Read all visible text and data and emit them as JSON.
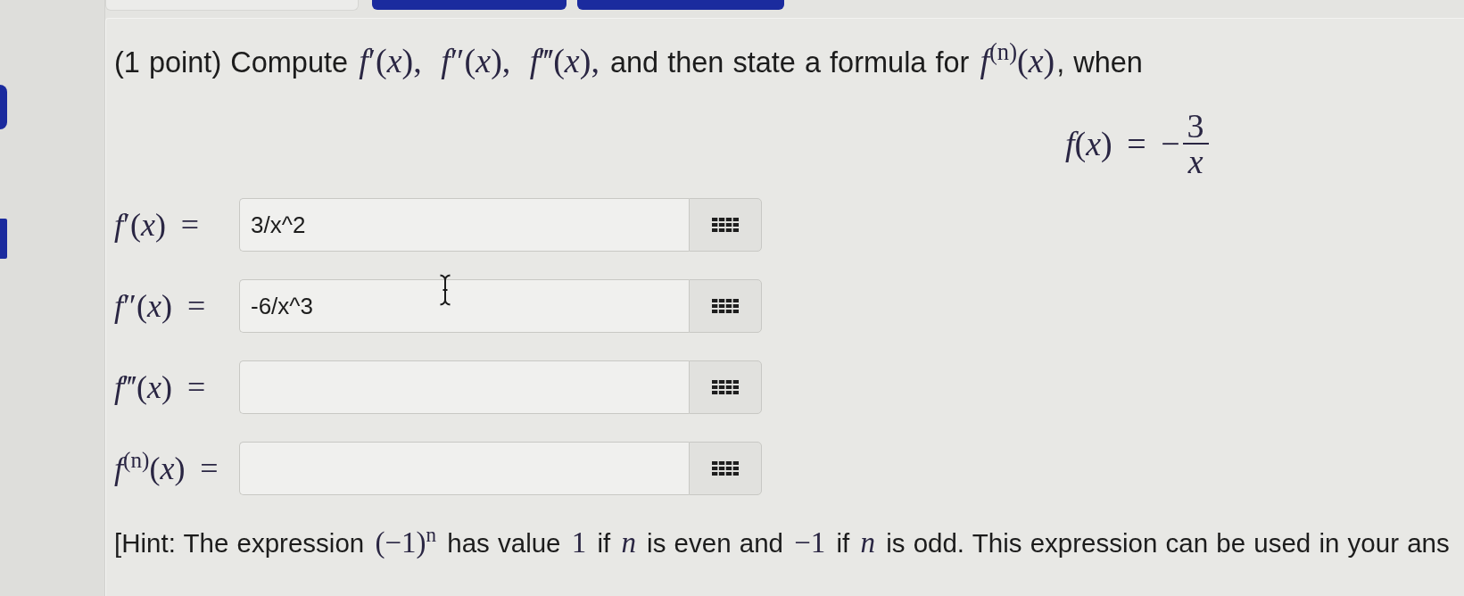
{
  "problem": [
    {
      "kind": "text",
      "text": "(1 point) Compute "
    },
    {
      "kind": "math",
      "text": "*f*′(*x*),"
    },
    {
      "kind": "math",
      "text": " *f*″(*x*),"
    },
    {
      "kind": "math",
      "text": " *f*‴(*x*),"
    },
    {
      "kind": "text",
      "text": " and then state a formula for "
    },
    {
      "kind": "math",
      "text": "*f*$^{(n)}$(*x*)"
    },
    {
      "kind": "text",
      "text": ", when"
    }
  ],
  "formula": {
    "lhs": "*f*(*x*) = −",
    "numerator": "3",
    "denominator": "*x*"
  },
  "answers": [
    {
      "label": "*f*′(*x*) =",
      "value": "3/x^2",
      "hovered": false
    },
    {
      "label": "*f*″(*x*) =",
      "value": "-6/x^3",
      "hovered": true
    },
    {
      "label": "*f*‴(*x*) =",
      "hovered": false
    },
    {
      "label": "*f*$^{(n)}$(*x*) =",
      "hovered": false
    }
  ],
  "hint": [
    {
      "kind": "text",
      "text": "[Hint: The expression "
    },
    {
      "kind": "math",
      "text": "(−1)$^{n}$"
    },
    {
      "kind": "text",
      "text": " has value "
    },
    {
      "kind": "math",
      "text": "1"
    },
    {
      "kind": "text",
      "text": " if "
    },
    {
      "kind": "math",
      "text": "*n*"
    },
    {
      "kind": "text",
      "text": " is even and "
    },
    {
      "kind": "math",
      "text": "−1"
    },
    {
      "kind": "text",
      "text": " if "
    },
    {
      "kind": "math",
      "text": "*n*"
    },
    {
      "kind": "text",
      "text": " is odd. This expression can be used in your ans"
    }
  ]
}
